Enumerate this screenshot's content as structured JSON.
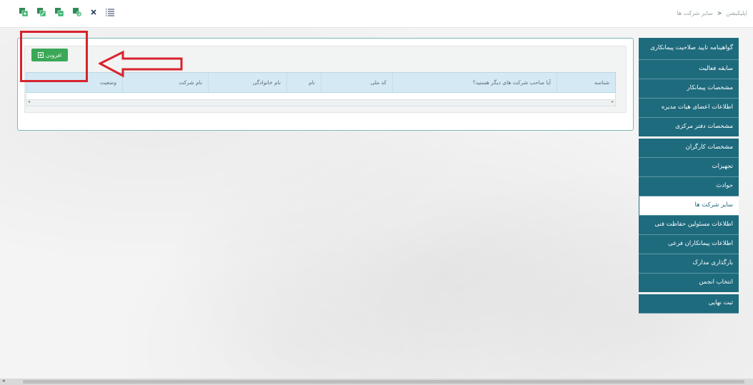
{
  "toolbar": {
    "icons": [
      "grid-add-icon",
      "grid-edit-icon",
      "grid-copy-icon",
      "grid-refresh-icon",
      "close-icon",
      "list-icon"
    ]
  },
  "breadcrumb": {
    "root": "اپلیکیشن",
    "separator": "<",
    "current": "سایر شرکت ها"
  },
  "sidebar": {
    "items": [
      {
        "label": "گواهینامه تایید صلاحیت پیمانکاری"
      },
      {
        "label": "سابقه فعالیت"
      },
      {
        "label": "مشخصات پیمانکار"
      },
      {
        "label": "اطلاعات اعضای هیات مدیره"
      },
      {
        "label": "مشخصات دفتر مرکزی"
      },
      {
        "label": "مشخصات کارگران"
      },
      {
        "label": "تجهیزات"
      },
      {
        "label": "حوادث"
      },
      {
        "label": "سایر شرکت ها"
      },
      {
        "label": "اطلاعات مسئولین حفاظت فنی"
      },
      {
        "label": "اطلاعات پیمانکاران فرعی"
      },
      {
        "label": "بارگذاری مدارک"
      },
      {
        "label": "انتخاب انجمن"
      },
      {
        "label": "ثبت نهایی"
      }
    ],
    "active_label": "سایر شرکت ها",
    "colors": {
      "bg": "#1e6b7e",
      "active_bg": "#ffffff"
    }
  },
  "panel": {
    "add_button": "افزودن"
  },
  "grid": {
    "columns": [
      "شناسه",
      "آیا صاحب شرکت های دیگر هستید؟",
      "کد ملی",
      "نام",
      "نام خانوادگی",
      "نام شرکت",
      "وضعیت"
    ],
    "rows": []
  },
  "annotation": {
    "highlight_color": "#d7232d"
  }
}
